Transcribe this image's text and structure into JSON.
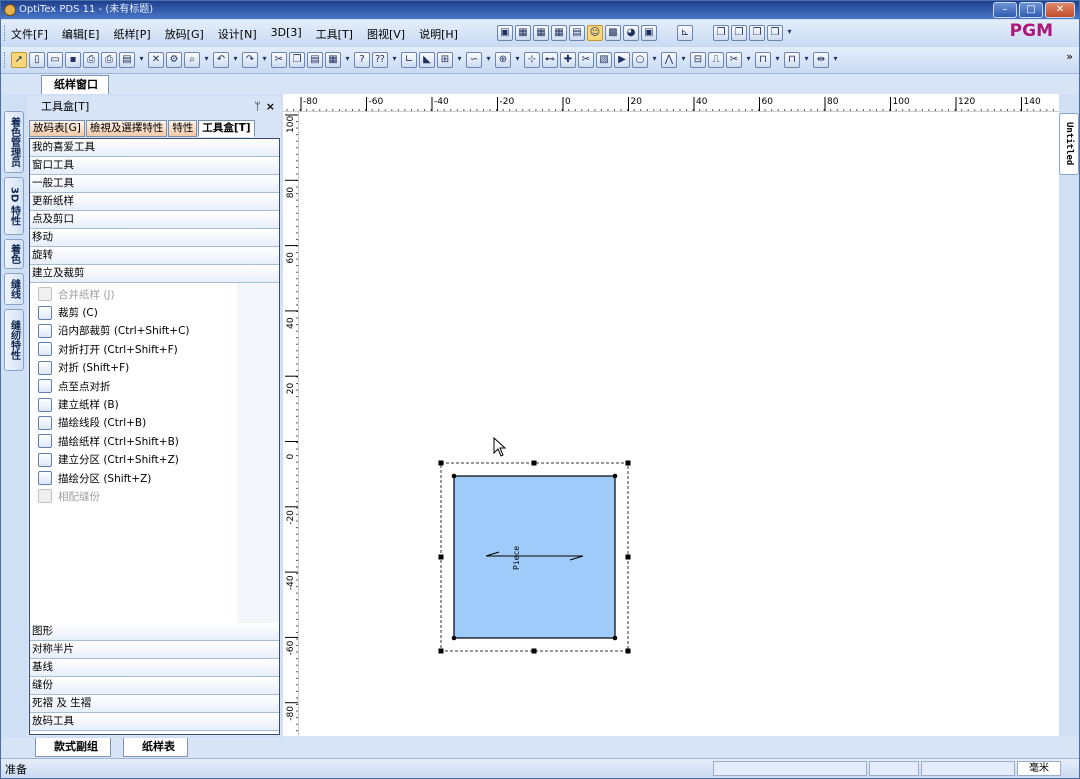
{
  "window": {
    "title": "OptiTex PDS 11 - (未有标题)"
  },
  "brand": "PGM",
  "menu": [
    "文件[F]",
    "编辑[E]",
    "纸样[P]",
    "放码[G]",
    "设计[N]",
    "3D[3]",
    "工具[T]",
    "图视[V]",
    "说明[H]"
  ],
  "doc_tab": "纸样窗口",
  "side_tabs": [
    "着色管理员",
    "3D 特性",
    "着色",
    "缝线",
    "缝纫特性"
  ],
  "right_tab": "Untitled",
  "panel": {
    "title": "工具盒[T]",
    "pin": "ᛘ",
    "close": "×",
    "tabs": [
      "放码表[G]",
      "檢視及選擇特性",
      "特性",
      "工具盒[T]"
    ],
    "sections_top": [
      "我的喜爱工具",
      "窗口工具",
      "一般工具",
      "更新纸样",
      "点及剪口",
      "移动",
      "旋转",
      "建立及裁剪"
    ],
    "commands": [
      {
        "label": "合并纸样 (J)",
        "enabled": false
      },
      {
        "label": "裁剪 (C)",
        "enabled": true
      },
      {
        "label": "沿内部裁剪 (Ctrl+Shift+C)",
        "enabled": true
      },
      {
        "label": "对折打开 (Ctrl+Shift+F)",
        "enabled": true
      },
      {
        "label": "对折 (Shift+F)",
        "enabled": true
      },
      {
        "label": "点至点对折",
        "enabled": true
      },
      {
        "label": "建立纸样 (B)",
        "enabled": true
      },
      {
        "label": "描绘线段 (Ctrl+B)",
        "enabled": true
      },
      {
        "label": "描绘纸样 (Ctrl+Shift+B)",
        "enabled": true
      },
      {
        "label": "建立分区 (Ctrl+Shift+Z)",
        "enabled": true
      },
      {
        "label": "描绘分区 (Shift+Z)",
        "enabled": true
      },
      {
        "label": "相配缝份",
        "enabled": false
      }
    ],
    "sections_bottom": [
      "图形",
      "对称半片",
      "基线",
      "缝份",
      "死褶 及 生褶",
      "放码工具"
    ]
  },
  "ruler": {
    "top": [
      "-80",
      "-60",
      "-40",
      "-20",
      "0",
      "20",
      "40",
      "60",
      "80",
      "100",
      "120",
      "140"
    ],
    "left": [
      "100",
      "80",
      "60",
      "40",
      "20",
      "0",
      "-20",
      "-40",
      "-60",
      "-80"
    ]
  },
  "piece": {
    "label": "Piece",
    "fill": "#9ecbfa"
  },
  "bottom_tabs": [
    "款式副组",
    "纸样表"
  ],
  "status": {
    "ready": "准备",
    "unit": "毫米"
  }
}
